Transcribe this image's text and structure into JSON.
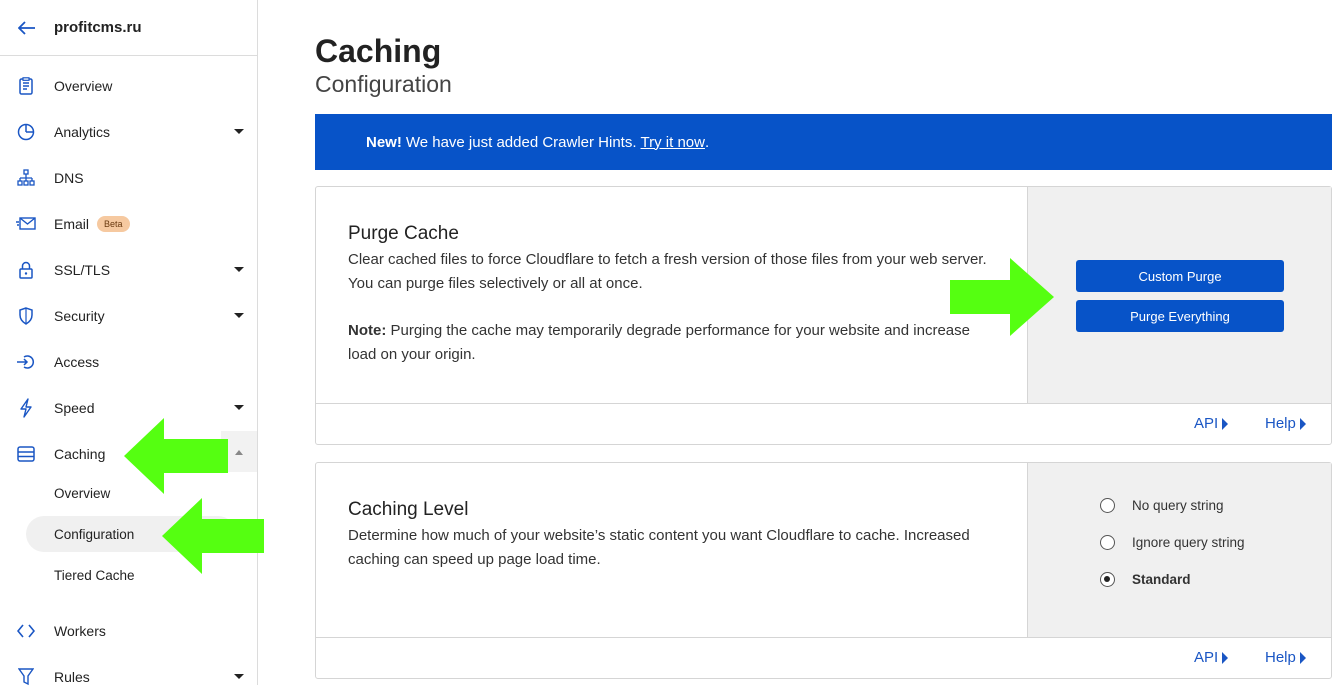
{
  "sidebar": {
    "site_name": "profitcms.ru",
    "items": [
      {
        "label": "Overview"
      },
      {
        "label": "Analytics"
      },
      {
        "label": "DNS"
      },
      {
        "label": "Email",
        "badge": "Beta"
      },
      {
        "label": "SSL/TLS"
      },
      {
        "label": "Security"
      },
      {
        "label": "Access"
      },
      {
        "label": "Speed"
      },
      {
        "label": "Caching"
      },
      {
        "label": "Workers"
      },
      {
        "label": "Rules"
      }
    ],
    "caching_sub": [
      {
        "label": "Overview"
      },
      {
        "label": "Configuration",
        "active": true
      },
      {
        "label": "Tiered Cache"
      }
    ]
  },
  "page": {
    "title": "Caching",
    "subtitle": "Configuration"
  },
  "banner": {
    "bold": "New!",
    "text": "We have just added Crawler Hints.",
    "link": "Try it now",
    "tail": "."
  },
  "purge_card": {
    "title": "Purge Cache",
    "desc": "Clear cached files to force Cloudflare to fetch a fresh version of those files from your web server. You can purge files selectively or all at once.",
    "note_label": "Note:",
    "note_text": "Purging the cache may temporarily degrade performance for your website and increase load on your origin.",
    "btn_custom": "Custom Purge",
    "btn_everything": "Purge Everything",
    "api": "API",
    "help": "Help"
  },
  "level_card": {
    "title": "Caching Level",
    "desc": "Determine how much of your website’s static content you want Cloudflare to cache. Increased caching can speed up page load time.",
    "options": [
      {
        "label": "No query string",
        "checked": false
      },
      {
        "label": "Ignore query string",
        "checked": false
      },
      {
        "label": "Standard",
        "checked": true
      }
    ],
    "api": "API",
    "help": "Help"
  },
  "colors": {
    "accent": "#0753c8",
    "annotation_arrow": "#55ff11",
    "beta_badge": "#f6c9a0"
  }
}
